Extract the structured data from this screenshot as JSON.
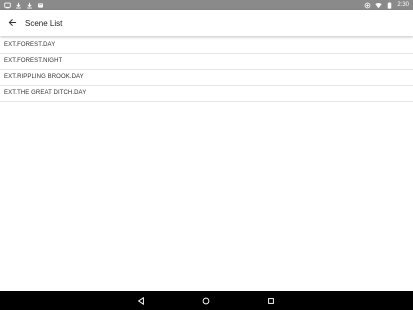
{
  "status_bar": {
    "left_icons": [
      "screenshot-icon",
      "download-icon",
      "download-icon",
      "notification-icon"
    ],
    "right_icons": [
      "data-saver-icon",
      "wifi-icon",
      "battery-icon"
    ],
    "time": "2:30"
  },
  "app_bar": {
    "back_icon": "arrow-left-icon",
    "title": "Scene List"
  },
  "scenes": [
    "EXT.FOREST.DAY",
    "EXT.FOREST.NIGHT",
    "EXT.RIPPLING BROOK.DAY",
    "EXT.THE GREAT DITCH.DAY"
  ],
  "nav_bar": {
    "buttons": [
      "back-triangle-icon",
      "home-circle-icon",
      "recents-square-icon"
    ]
  },
  "colors": {
    "status_bar_bg": "#8a8a8a",
    "app_bar_bg": "#ffffff",
    "nav_bar_bg": "#000000",
    "divider": "#e6e6e6"
  }
}
